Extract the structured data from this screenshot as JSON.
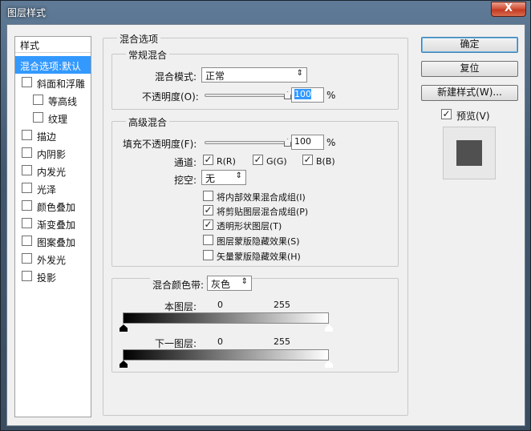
{
  "window": {
    "title": "图层样式",
    "close_label": "X"
  },
  "style_list": {
    "header": "样式",
    "items": [
      {
        "label": "混合选项:默认",
        "checkbox": false,
        "selected": true
      },
      {
        "label": "斜面和浮雕",
        "checkbox": true,
        "checked": false
      },
      {
        "label": "等高线",
        "checkbox": true,
        "checked": false,
        "indent": true
      },
      {
        "label": "纹理",
        "checkbox": true,
        "checked": false,
        "indent": true
      },
      {
        "label": "描边",
        "checkbox": true,
        "checked": false
      },
      {
        "label": "内阴影",
        "checkbox": true,
        "checked": false
      },
      {
        "label": "内发光",
        "checkbox": true,
        "checked": false
      },
      {
        "label": "光泽",
        "checkbox": true,
        "checked": false
      },
      {
        "label": "颜色叠加",
        "checkbox": true,
        "checked": false
      },
      {
        "label": "渐变叠加",
        "checkbox": true,
        "checked": false
      },
      {
        "label": "图案叠加",
        "checkbox": true,
        "checked": false
      },
      {
        "label": "外发光",
        "checkbox": true,
        "checked": false
      },
      {
        "label": "投影",
        "checkbox": true,
        "checked": false
      }
    ]
  },
  "blend_options": {
    "title": "混合选项",
    "general": {
      "title": "常规混合",
      "mode_label": "混合模式:",
      "mode_value": "正常",
      "opacity_label": "不透明度(O):",
      "opacity_value": "100",
      "opacity_unit": "%",
      "opacity_level": 1.0
    },
    "advanced": {
      "title": "高级混合",
      "fill_label": "填充不透明度(F):",
      "fill_value": "100",
      "fill_unit": "%",
      "fill_level": 1.0,
      "channels_label": "通道:",
      "channel_r": "R(R)",
      "channel_g": "G(G)",
      "channel_b": "B(B)",
      "knockout_label": "挖空:",
      "knockout_value": "无",
      "opt1": "将内部效果混合成组(I)",
      "opt2": "将剪贴图层混合成组(P)",
      "opt3": "透明形状图层(T)",
      "opt4": "图层蒙版隐藏效果(S)",
      "opt5": "矢量蒙版隐藏效果(H)"
    },
    "blend_if": {
      "label": "混合颜色带:",
      "value": "灰色",
      "this_layer_label": "本图层:",
      "this_min": "0",
      "this_max": "255",
      "under_layer_label": "下一图层:",
      "under_min": "0",
      "under_max": "255"
    }
  },
  "buttons": {
    "ok": "确定",
    "reset": "复位",
    "new_style": "新建样式(W)...",
    "preview_label": "预览(V)"
  },
  "checkmark": "✓",
  "colors": {
    "selection": "#3399ff",
    "preview_swatch": "#505050"
  }
}
